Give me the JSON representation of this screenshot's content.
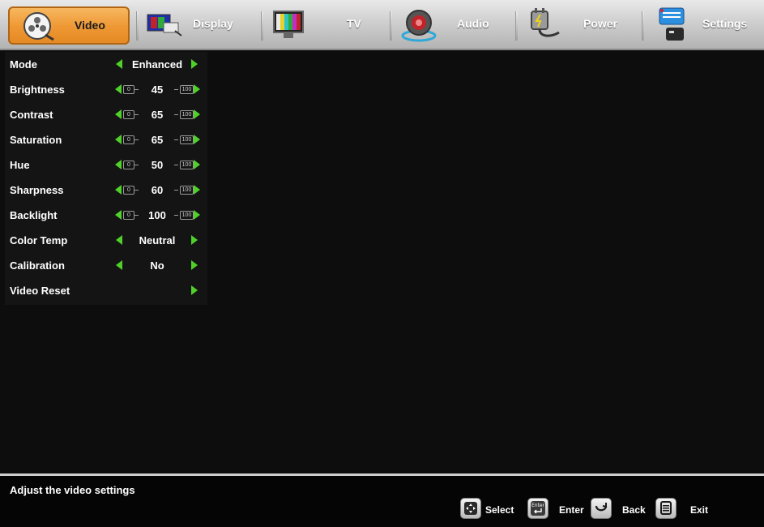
{
  "tabs": [
    {
      "label": "Video",
      "icon": "film-reel-icon",
      "active": true
    },
    {
      "label": "Display",
      "icon": "display-icon"
    },
    {
      "label": "TV",
      "icon": "tv-icon"
    },
    {
      "label": "Audio",
      "icon": "speaker-icon"
    },
    {
      "label": "Power",
      "icon": "power-plug-icon"
    },
    {
      "label": "Settings",
      "icon": "settings-icon"
    }
  ],
  "menu": {
    "items": [
      {
        "name": "Mode",
        "value": "Enhanced"
      },
      {
        "name": "Brightness",
        "value": "45",
        "min": "0",
        "max": "100"
      },
      {
        "name": "Contrast",
        "value": "65",
        "min": "0",
        "max": "100"
      },
      {
        "name": "Saturation",
        "value": "65",
        "min": "0",
        "max": "100"
      },
      {
        "name": "Hue",
        "value": "50",
        "min": "0",
        "max": "100"
      },
      {
        "name": "Sharpness",
        "value": "60",
        "min": "0",
        "max": "100"
      },
      {
        "name": "Backlight",
        "value": "100",
        "min": "0",
        "max": "100"
      },
      {
        "name": "Color Temp",
        "value": "Neutral"
      },
      {
        "name": "Calibration",
        "value": "No"
      },
      {
        "name": "Video Reset",
        "value": ""
      }
    ]
  },
  "help": {
    "text": "Adjust the video settings",
    "select_label": "Select",
    "enter_label": "Enter",
    "enter_key_text": "Enter",
    "back_label": "Back",
    "exit_label": "Exit"
  },
  "colors": {
    "active_tab": "#ee9733",
    "arrow": "#4fd12a",
    "background": "#0d0d0d"
  }
}
